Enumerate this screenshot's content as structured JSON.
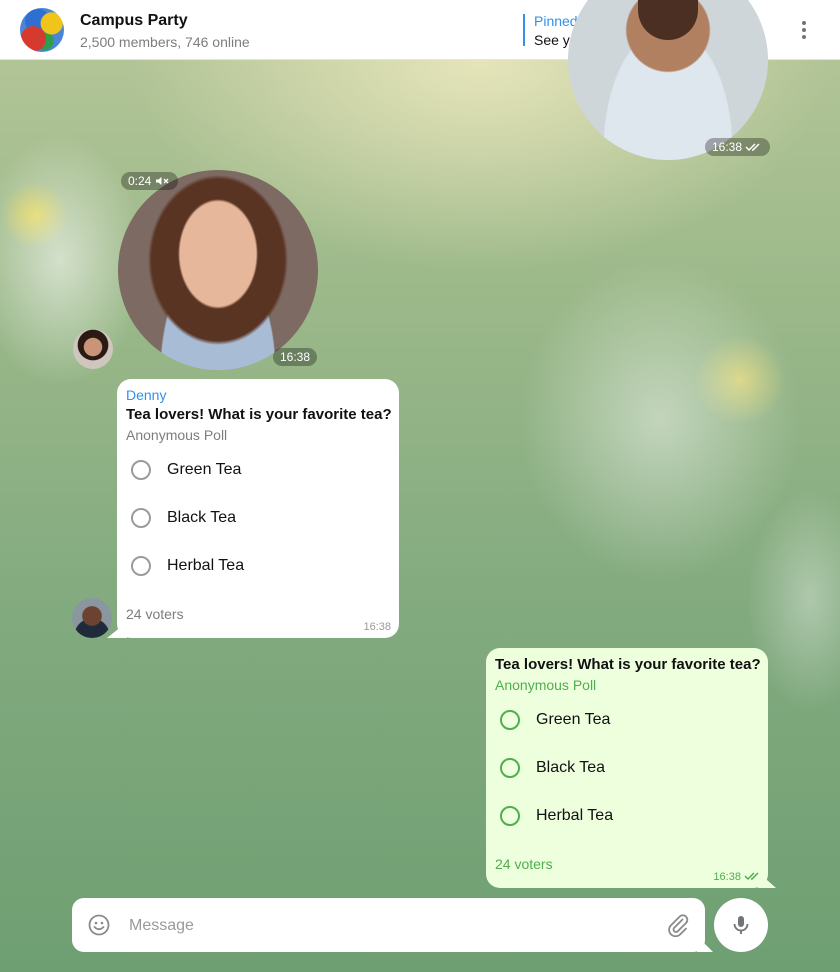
{
  "header": {
    "title": "Campus Party",
    "subtitle": "2,500 members, 746 online",
    "pinned_title": "Pinned message",
    "pinned_text": "See you tomorrow at 18:00..."
  },
  "messages": {
    "video_out": {
      "time": "16:38"
    },
    "video_in": {
      "duration": "0:24",
      "time": "16:38"
    },
    "poll_in": {
      "sender": "Denny",
      "question": "Tea lovers! What is your favorite tea?",
      "type": "Anonymous Poll",
      "options": [
        "Green Tea",
        "Black Tea",
        "Herbal Tea"
      ],
      "voters": "24 voters",
      "time": "16:38"
    },
    "poll_out": {
      "question": "Tea lovers! What is your favorite tea?",
      "type": "Anonymous Poll",
      "options": [
        "Green Tea",
        "Black Tea",
        "Herbal Tea"
      ],
      "voters": "24 voters",
      "time": "16:38"
    }
  },
  "composer": {
    "placeholder": "Message"
  },
  "icons": {
    "search": "search-icon",
    "menu": "more-vertical-icon",
    "emoji": "emoji-icon",
    "attach": "paperclip-icon",
    "mic": "microphone-icon",
    "read": "double-check-icon",
    "muted": "muted-speaker-icon"
  },
  "colors": {
    "accent": "#3390ec",
    "outgoing_bubble": "#eeffde",
    "outgoing_accent": "#4fae4e"
  }
}
